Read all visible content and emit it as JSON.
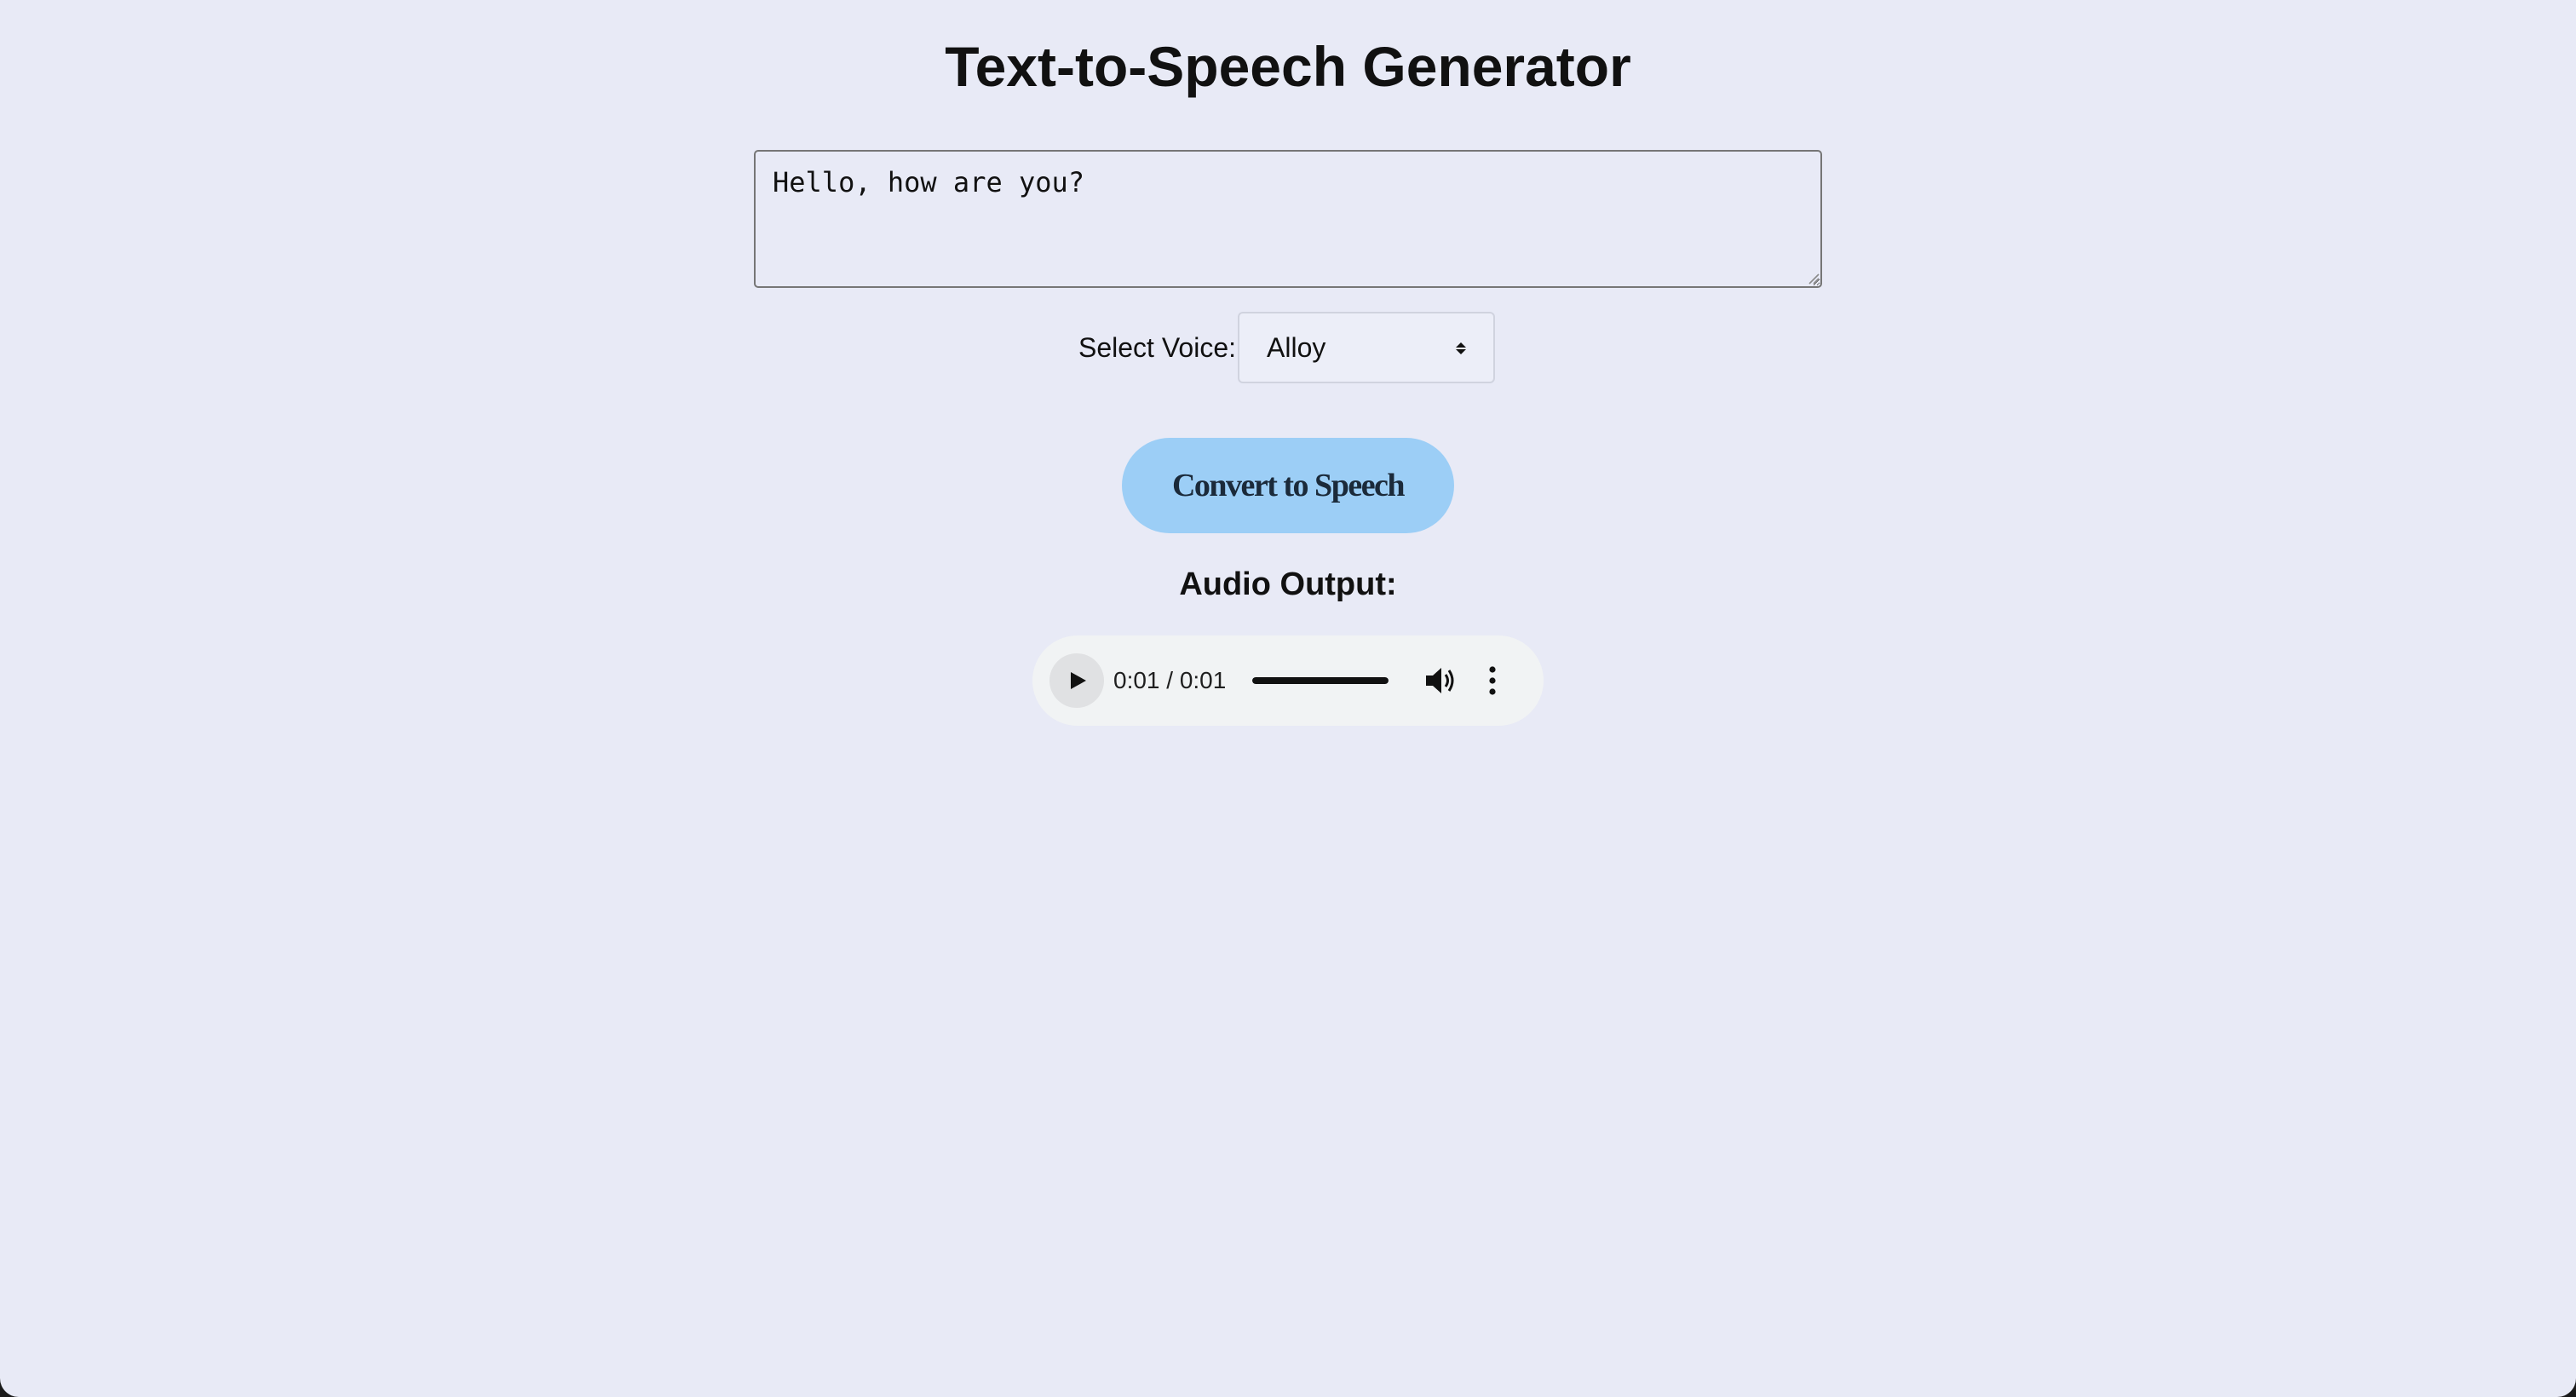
{
  "page": {
    "title": "Text-to-Speech Generator"
  },
  "input": {
    "text_value": "Hello, how are you?"
  },
  "voice": {
    "label": "Select Voice:",
    "selected": "Alloy"
  },
  "convert_button": {
    "label": "Convert to Speech"
  },
  "audio": {
    "heading": "Audio Output:",
    "time_readout": "0:01 / 0:01",
    "progress_fraction": 1.0
  },
  "colors": {
    "page_background": "#e8eaf6",
    "button_background": "#9ccef6",
    "player_background": "#f1f3f4"
  },
  "icons": [
    "play-icon",
    "volume-icon",
    "more-options-icon",
    "select-arrows-icon",
    "resize-grip-icon"
  ]
}
